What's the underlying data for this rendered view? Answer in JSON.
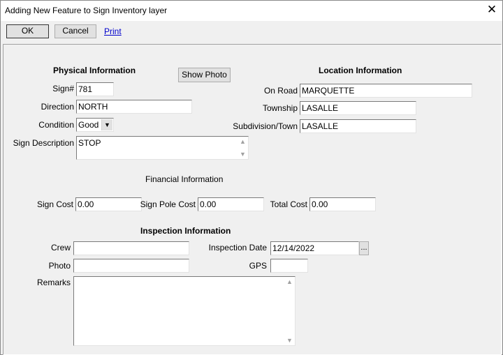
{
  "window": {
    "title": "Adding New Feature to Sign Inventory layer"
  },
  "toolbar": {
    "ok_label": "OK",
    "cancel_label": "Cancel",
    "print_label": "Print"
  },
  "physical": {
    "header": "Physical Information",
    "sign_no_label": "Sign#",
    "sign_no_value": "781",
    "direction_label": "Direction",
    "direction_value": "NORTH",
    "condition_label": "Condition",
    "condition_value": "Good",
    "description_label": "Sign Description",
    "description_value": "STOP",
    "show_photo_label": "Show Photo"
  },
  "location": {
    "header": "Location Information",
    "on_road_label": "On Road",
    "on_road_value": "MARQUETTE",
    "township_label": "Township",
    "township_value": "LASALLE",
    "subdivision_label": "Subdivision/Town",
    "subdivision_value": "LASALLE"
  },
  "financial": {
    "header": "Financial Information",
    "sign_cost_label": "Sign Cost",
    "sign_cost_value": "0.00",
    "pole_cost_label": "Sign Pole Cost",
    "pole_cost_value": "0.00",
    "total_cost_label": "Total Cost",
    "total_cost_value": "0.00"
  },
  "inspection": {
    "header": "Inspection Information",
    "crew_label": "Crew",
    "crew_value": "",
    "photo_label": "Photo",
    "photo_value": "",
    "date_label": "Inspection Date",
    "date_value": "12/14/2022",
    "date_button": "...",
    "gps_label": "GPS",
    "gps_value": "",
    "remarks_label": "Remarks",
    "remarks_value": ""
  }
}
